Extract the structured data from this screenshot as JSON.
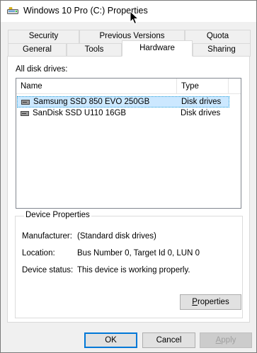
{
  "window": {
    "title": "Windows 10 Pro (C:) Properties"
  },
  "tabs": {
    "row1": [
      "Security",
      "Previous Versions",
      "Quota"
    ],
    "row2": [
      "General",
      "Tools",
      "Hardware",
      "Sharing"
    ],
    "active": "Hardware"
  },
  "hardware": {
    "all_disk_drives_label": "All disk drives:",
    "columns": {
      "name": "Name",
      "type": "Type"
    },
    "rows": [
      {
        "name": "Samsung SSD 850 EVO 250GB",
        "type": "Disk drives",
        "selected": true
      },
      {
        "name": "SanDisk SSD U110 16GB",
        "type": "Disk drives",
        "selected": false
      }
    ],
    "device_properties": {
      "title": "Device Properties",
      "manufacturer_label": "Manufacturer:",
      "manufacturer_value": "(Standard disk drives)",
      "location_label": "Location:",
      "location_value": "Bus Number 0, Target Id 0, LUN 0",
      "status_label": "Device status:",
      "status_value": "This device is working properly.",
      "properties_button": "Properties",
      "properties_button_rest": "roperties",
      "properties_button_accel": "P"
    }
  },
  "footer": {
    "ok": "OK",
    "cancel": "Cancel",
    "apply": "Apply",
    "apply_accel": "A",
    "apply_rest": "pply"
  },
  "colors": {
    "selection_bg": "#cce8ff",
    "selection_border": "#26a0da",
    "default_button_border": "#0078d7"
  }
}
